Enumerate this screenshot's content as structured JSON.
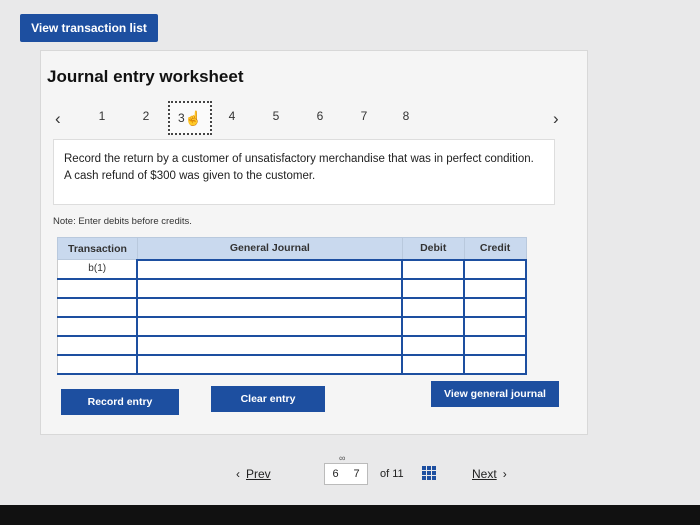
{
  "top": {
    "view_transactions_label": "View transaction list"
  },
  "worksheet": {
    "title": "Journal entry worksheet",
    "steps": [
      "1",
      "2",
      "3",
      "4",
      "5",
      "6",
      "7",
      "8"
    ],
    "active_step": "3",
    "instruction": "Record the return by a customer of unsatisfactory merchandise that was in perfect condition. A cash refund of $300 was given to the customer.",
    "note": "Note: Enter debits before credits.",
    "table": {
      "headers": [
        "Transaction",
        "General Journal",
        "Debit",
        "Credit"
      ],
      "rows": [
        "b(1)",
        "",
        "",
        "",
        "",
        ""
      ]
    },
    "buttons": {
      "record": "Record entry",
      "clear": "Clear entry",
      "view_journal": "View general journal"
    }
  },
  "pager": {
    "prev": "Prev",
    "pages": [
      "6",
      "7"
    ],
    "of": "of 11",
    "next": "Next"
  },
  "colors": {
    "accent": "#1d4fa0",
    "header_bg": "#c9d9ee"
  }
}
